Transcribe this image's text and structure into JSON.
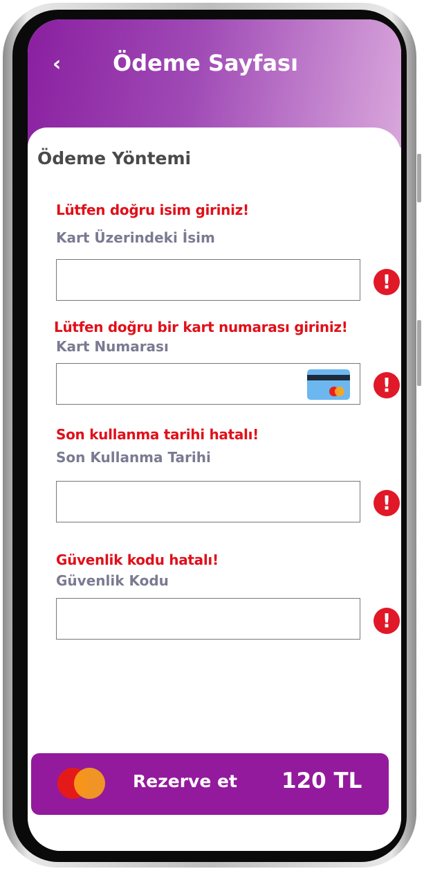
{
  "header": {
    "title": "Ödeme Sayfası",
    "back_icon": "‹"
  },
  "section_title": "Ödeme Yöntemi",
  "fields": [
    {
      "error": "Lütfen doğru isim giriniz!",
      "label": "Kart Üzerindeki İsim",
      "value": ""
    },
    {
      "error": "Lütfen doğru bir kart numarası giriniz!",
      "label": "Kart Numarası",
      "value": ""
    },
    {
      "error": "Son kullanma tarihi hatalı!",
      "label": "Son Kullanma Tarihi",
      "value": ""
    },
    {
      "error": "Güvenlik kodu hatalı!",
      "label": "Güvenlik Kodu",
      "value": ""
    }
  ],
  "alert_icon": "!",
  "footer": {
    "button_label": "Rezerve et",
    "price": "120 TL"
  },
  "colors": {
    "header_start": "#8a1fa0",
    "header_end": "#d9a7dc",
    "error_text": "#e0101a",
    "alert_icon": "#e01828",
    "button_bg": "#931a9c"
  },
  "icons": [
    "chevron-left-icon",
    "alert-circle-icon",
    "credit-card-icon",
    "mastercard-icon"
  ]
}
